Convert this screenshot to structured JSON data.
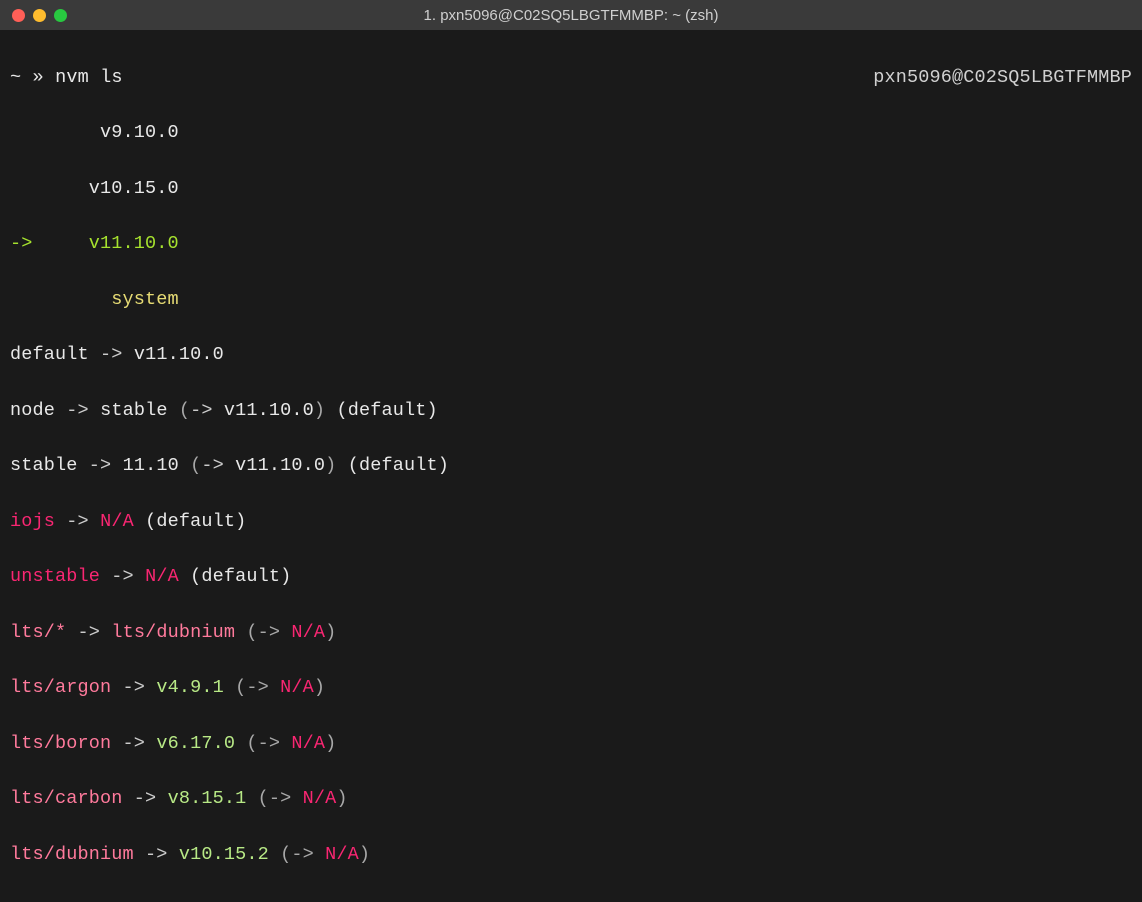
{
  "window": {
    "title": "1. pxn5096@C02SQ5LBGTFMMBP: ~ (zsh)"
  },
  "prompt": {
    "tilde": "~",
    "chevrons": "»",
    "command": "nvm ls",
    "rprompt": "pxn5096@C02SQ5LBGTFMMBP"
  },
  "versions": {
    "v1": "v9.10.0",
    "v2": "v10.15.0",
    "current_arrow": "->",
    "v3": "v11.10.0",
    "system": "system"
  },
  "aliases": {
    "default": {
      "name": "default",
      "target": "v11.10.0"
    },
    "node": {
      "name": "node",
      "mid": "stable",
      "target": "v11.10.0",
      "suffix": "(default)"
    },
    "stable": {
      "name": "stable",
      "mid": "11.10",
      "target": "v11.10.0",
      "suffix": "(default)"
    },
    "iojs": {
      "name": "iojs",
      "na": "N/A",
      "suffix": "(default)"
    },
    "unstable": {
      "name": "unstable",
      "na": "N/A",
      "suffix": "(default)"
    }
  },
  "lts": {
    "star": {
      "name": "lts/*",
      "mid": "lts/dubnium",
      "arrow_open": "(->",
      "na": "N/A",
      "close": ")"
    },
    "argon": {
      "name": "lts/argon",
      "ver": "v4.9.1",
      "arrow_open": "(->",
      "na": "N/A",
      "close": ")"
    },
    "boron": {
      "name": "lts/boron",
      "ver": "v6.17.0",
      "arrow_open": "(->",
      "na": "N/A",
      "close": ")"
    },
    "carbon": {
      "name": "lts/carbon",
      "ver": "v8.15.1",
      "arrow_open": "(->",
      "na": "N/A",
      "close": ")"
    },
    "dubnium": {
      "name": "lts/dubnium",
      "ver": "v10.15.2",
      "arrow_open": "(->",
      "na": "N/A",
      "close": ")"
    }
  },
  "arrow": "->"
}
